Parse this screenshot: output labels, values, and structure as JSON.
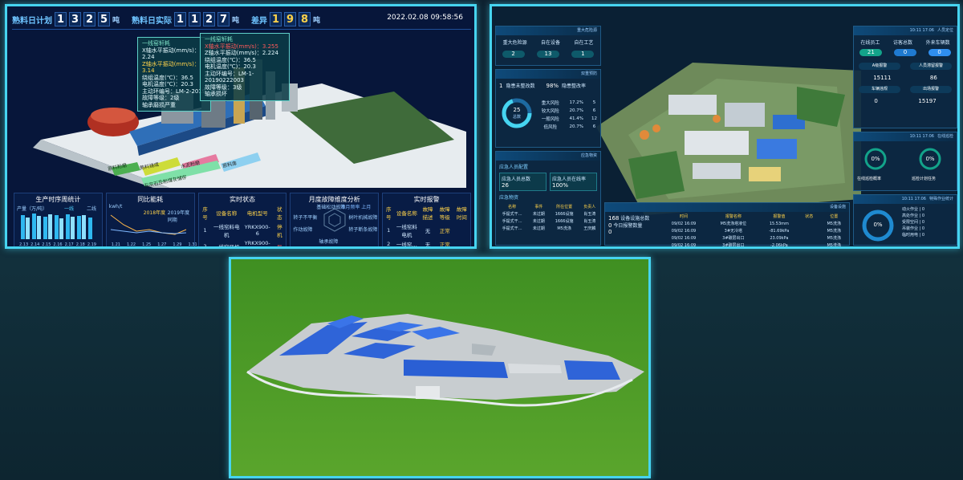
{
  "dash1": {
    "plan_label": "熟料日计划",
    "plan_digits": [
      "1",
      "3",
      "2",
      "5"
    ],
    "unit": "吨",
    "actual_label": "熟料日实际",
    "actual_digits": [
      "1",
      "1",
      "2",
      "7"
    ],
    "diff_label": "差异",
    "diff_digits": [
      "1",
      "9",
      "8"
    ],
    "datetime": "2022.02.08 09:58:56",
    "popup_a": {
      "title": "一线窑轩耗",
      "lines": [
        "X轴水平振动(mm/s)：2.24",
        "Z轴水平振动(mm/s)：3.14",
        "绕组温度(℃)：36.5",
        "电机温度(℃)：20.3",
        "主动环编号：LM-2-2019",
        "故障等级：2级",
        "轴承磨损严重"
      ]
    },
    "popup_b": {
      "title": "一线窑轩耗",
      "lines": [
        "X轴水平振动(mm/s)：3.255",
        "Z轴水平振动(mm/s)：2.224",
        "绕组温度(℃)：36.5",
        "电机温度(℃)：20.3",
        "主动环编号：LM-1-20190222003",
        "故障等级：3级",
        "轴承损坏"
      ]
    },
    "tags": [
      "原料粉磨",
      "熟料烧成",
      "水泥粉磨",
      "石灰石及粉煤灰储存",
      "原料库"
    ],
    "panels": {
      "prod_title": "生产时序周统计",
      "prod_unit": "产量（万/吨）",
      "prod_legend": [
        "一线",
        "二线"
      ],
      "prod_x": [
        "2.13",
        "2.14",
        "2.15",
        "2.16",
        "2.17",
        "2.18",
        "2.19"
      ],
      "energy_title": "同比能耗",
      "energy_unit": "kwh/t",
      "energy_legend": [
        "2018年度",
        "2019年度同期"
      ],
      "energy_x": [
        "1.21",
        "1.22",
        "1.25",
        "1.27",
        "1.29",
        "1.31"
      ],
      "status_title": "实时状态",
      "status_headers": [
        "序号",
        "设备名称",
        "电机型号",
        "状态"
      ],
      "status_rows": [
        [
          "1",
          "一线窑料电机",
          "YRKX900-6",
          "停机"
        ],
        [
          "2",
          "一线窑风机",
          "YRKX900-6",
          "异"
        ]
      ],
      "fault_title": "月度故障维度分析",
      "fault_labels": [
        "基础松动故障",
        "对中不良",
        "转子不平衡",
        "轴承故障",
        "作动故障",
        "树叶机械故障",
        "转子断条故障"
      ],
      "fault_legend": "本月频率 上月",
      "alarm_title": "实时报警",
      "alarm_headers": [
        "序号",
        "设备名称",
        "故障描述",
        "故障等级",
        "故障时间"
      ],
      "alarm_rows": [
        [
          "1",
          "一线窑料电机",
          "无",
          "正常",
          ""
        ],
        [
          "2",
          "一线窑…",
          "无",
          "正常",
          ""
        ]
      ]
    }
  },
  "dash2": {
    "cards": {
      "c1_title": "重大危险源",
      "c1_labels": [
        "重大危险源",
        "自在设备",
        "自在工艺"
      ],
      "c1_vals": [
        "2",
        "13",
        "1"
      ],
      "c2_title": "双重预防",
      "c2_a": "1",
      "c2_a_label": "隐患未整改数",
      "c2_b": "98%",
      "c2_b_label": "隐患整改率",
      "c2_ring": "25",
      "c2_ring_label": "总数",
      "c2_rows": [
        [
          "重大风险",
          "17.2%",
          "5"
        ],
        [
          "较大风险",
          "20.7%",
          "6"
        ],
        [
          "一般风险",
          "41.4%",
          "12"
        ],
        [
          "低风险",
          "20.7%",
          "6"
        ]
      ],
      "c3_title": "应急物资",
      "c3_sub": "应急人员配置",
      "c3_a": "26",
      "c3_a_label": "应急人员总数",
      "c3_b": "100%",
      "c3_b_label": "应急人员在线率",
      "c3_sub2": "应急物资",
      "c3_headers": [
        "名称",
        "事件",
        "所在位置",
        "负责人"
      ],
      "c3_rows": [
        [
          "手提式干…",
          "未过期",
          "1666设施",
          "肖玉涛"
        ],
        [
          "手提式干…",
          "未过期",
          "1666设施",
          "肖玉涛"
        ],
        [
          "手提式干…",
          "未过期",
          "M5洗涤",
          "王庆麟"
        ]
      ],
      "c4_title": "设备设施",
      "c4_a": "168",
      "c4_a_label": "设备设施总数",
      "c4_b": "0",
      "c4_b_label": "今日报警数量",
      "c4_c": "0",
      "c4_headers": [
        "时间",
        "报警名称",
        "报警值",
        "状态",
        "位置"
      ],
      "c4_rows": [
        [
          "09/02 16:09",
          "M5洗涤塔液位",
          "15.53mm",
          "",
          "M5洗涤"
        ],
        [
          "09/02 16:09",
          "3#无冷塔",
          "-81.69kPa",
          "",
          "M5洗涤"
        ],
        [
          "09/02 16:09",
          "3#碳层出口",
          "23.09kPa",
          "",
          "M5洗涤"
        ],
        [
          "09/02 16:09",
          "3#碳层出口",
          "-2.06kPa",
          "",
          "M5洗涤"
        ]
      ],
      "r1_title": "人员定位",
      "r1_labels": [
        "在线员工",
        "访客总数",
        "外来车辆数"
      ],
      "r1_vals": [
        "21",
        "0",
        "0"
      ],
      "r1_items": [
        "A级报警",
        "人员滞留报警"
      ],
      "r1_nums": [
        "15111",
        "86",
        "0",
        "15197"
      ],
      "r1_items2": [
        "车辆违规",
        "出场报警"
      ],
      "r2_title": "在线巡检",
      "r2_a": "0%",
      "r2_a_label": "在线巡检概率",
      "r2_b": "0%",
      "r2_b_label": "巡检计划任务",
      "r3_title": "特殊作业统计",
      "r3_ring": "0%",
      "r3_items": [
        "动火作业",
        "高处作业",
        "受限空间",
        "吊装作业",
        "临时用电"
      ],
      "r3_vals": [
        "0",
        "0",
        "0",
        "0",
        "0"
      ],
      "time_tag": "10:11 17:06"
    }
  }
}
